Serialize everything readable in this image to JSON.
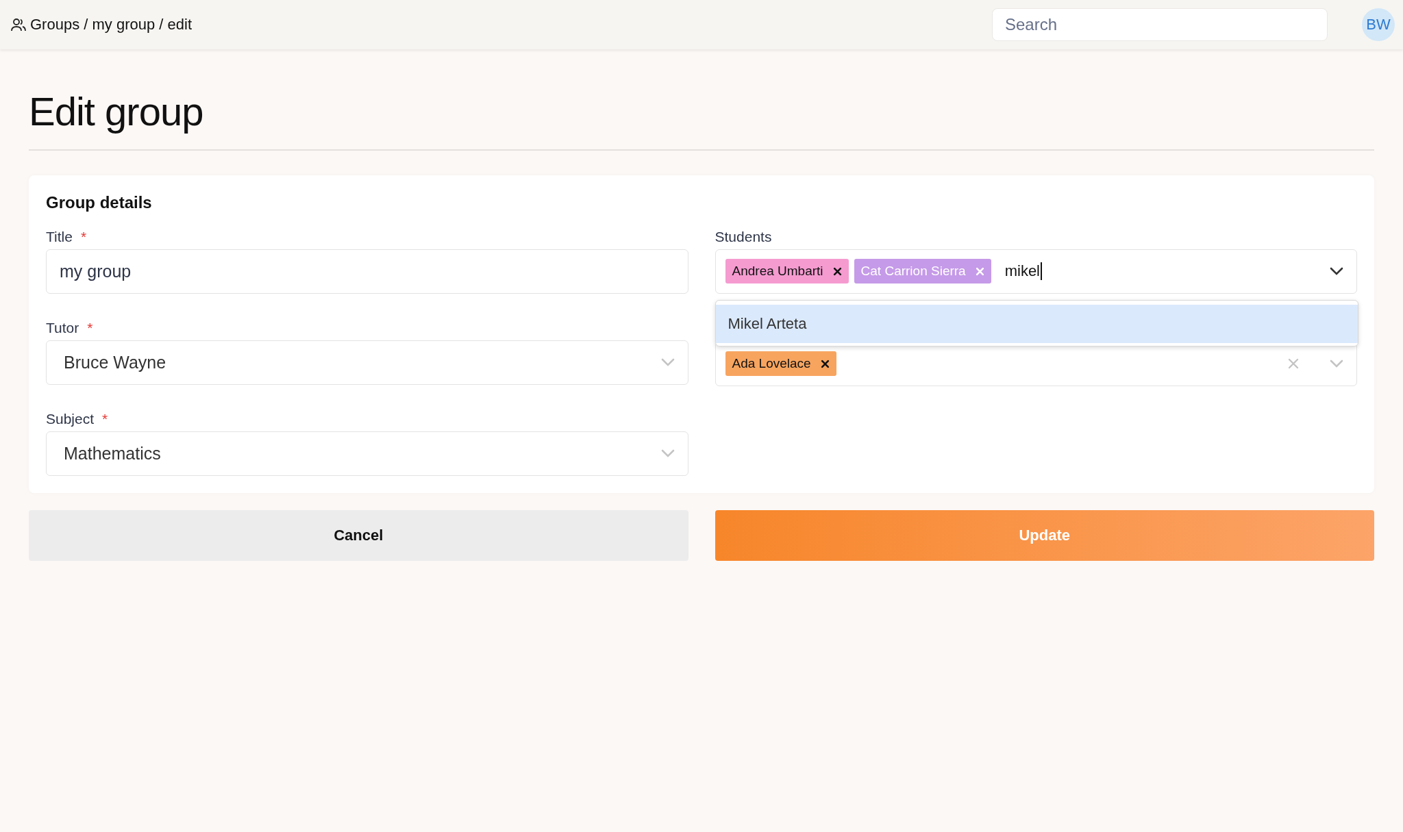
{
  "topbar": {
    "breadcrumb": "Groups / my group / edit",
    "search": {
      "placeholder": "Search"
    },
    "avatar": "BW"
  },
  "page_title": "Edit group",
  "card": {
    "title": "Group details",
    "fields": [
      {
        "kind": "text",
        "label": "Title",
        "required_mark": "*",
        "value": "my group"
      },
      {
        "kind": "select",
        "label": "Tutor",
        "required_mark": "*",
        "value": "Bruce Wayne"
      },
      {
        "kind": "select",
        "label": "Subject",
        "required_mark": "*",
        "value": "Mathematics"
      }
    ],
    "students": {
      "label": "Students",
      "tags": [
        {
          "label": "Andrea Umbarti",
          "color": "#f59bd0",
          "light_text": false
        },
        {
          "label": "Cat Carrion Sierra",
          "color": "#c59ae8",
          "light_text": true
        }
      ],
      "query": "mikel",
      "options": [
        {
          "label": "Mikel Arteta",
          "selected": true
        }
      ]
    },
    "second_select": {
      "tags": [
        {
          "label": "Ada Lovelace",
          "color": "#f7a45f",
          "light_text": false
        }
      ],
      "clearable": true
    }
  },
  "buttons": [
    {
      "label": "Cancel",
      "kind": "secondary"
    },
    {
      "label": "Update",
      "kind": "primary"
    }
  ]
}
